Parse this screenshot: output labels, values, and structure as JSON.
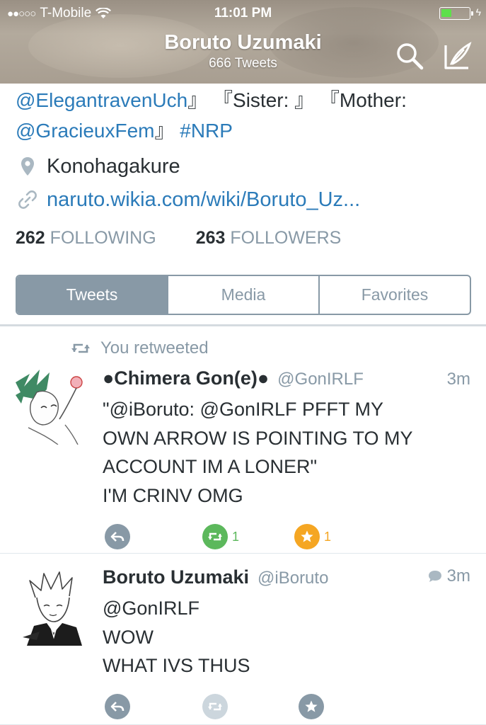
{
  "status_bar": {
    "carrier": "T-Mobile",
    "time": "11:01 PM"
  },
  "header": {
    "name": "Boruto Uzumaki",
    "tweet_count": "666 Tweets"
  },
  "bio": {
    "line1": {
      "mention1": "@ElegantravenUch",
      "rest": "』 『Sister: 』 『Mother:"
    },
    "line2": {
      "mention2": "@GracieuxFem",
      "sep": "』 ",
      "hashtag": "#NRP"
    }
  },
  "profile": {
    "location": "Konohagakure",
    "website": "naruto.wikia.com/wiki/Boruto_Uz..."
  },
  "stats": {
    "following_count": "262",
    "following_label": "FOLLOWING",
    "followers_count": "263",
    "followers_label": "FOLLOWERS"
  },
  "tabs": {
    "tweets": "Tweets",
    "media": "Media",
    "favorites": "Favorites",
    "selected": "Tweets"
  },
  "timeline": {
    "tweet1": {
      "retweet_note": "You retweeted",
      "name": "●Chimera Gon(e)●",
      "handle": "@GonIRLF",
      "time": "3m",
      "lines": [
        "\"@iBoruto: @GonIRLF PFFT MY",
        "OWN ARROW IS POINTING TO MY",
        "ACCOUNT IM A LONER\"",
        "I'M CRINV OMG"
      ],
      "retweet_count": "1",
      "favorite_count": "1"
    },
    "tweet2": {
      "name": "Boruto Uzumaki",
      "handle": "@iBoruto",
      "time": "3m",
      "lines": [
        "@GonIRLF",
        "WOW",
        "WHAT IVS THUS"
      ]
    }
  },
  "colors": {
    "link": "#2b7bb9",
    "muted": "#8899a6",
    "retweet_active": "#5cb85c",
    "favorite_active": "#f5a623",
    "action_default": "#8899a6",
    "action_disabled": "#ccd6dd"
  },
  "icons": {
    "search": "search-icon",
    "compose": "compose-icon",
    "location": "location-pin-icon",
    "link": "link-icon",
    "retweet": "retweet-icon",
    "reply": "reply-icon",
    "favorite": "star-icon",
    "conversation": "conversation-bubble-icon"
  }
}
